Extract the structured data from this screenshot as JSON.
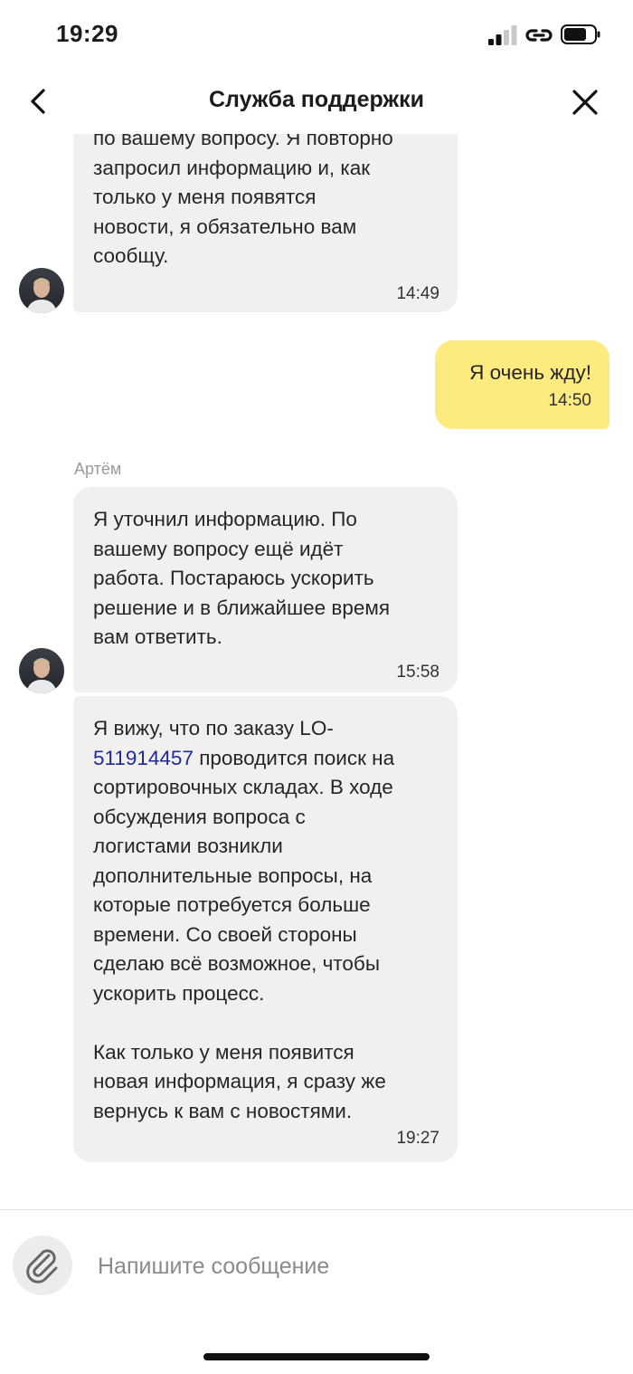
{
  "status_bar": {
    "time": "19:29",
    "icons": [
      "cellular-signal-icon",
      "link-icon",
      "battery-icon"
    ]
  },
  "header": {
    "title": "Служба поддержки",
    "back_icon": "chevron-left-icon",
    "close_icon": "close-icon"
  },
  "messages": [
    {
      "direction": "incoming",
      "text": "по вашему вопросу. Я повторно\nзапросил информацию и, как\nтолько у меня появятся\nновости, я обязательно вам\nсообщу.",
      "time": "14:49"
    },
    {
      "direction": "outgoing",
      "text": "Я очень жду!",
      "time": "14:50"
    },
    {
      "direction": "incoming",
      "sender": "Артём",
      "text": "Я уточнил информацию. По\nвашему вопросу ещё идёт\nработа. Постараюсь ускорить\nрешение и в ближайшее время\nвам ответить.",
      "time": "15:58"
    },
    {
      "direction": "incoming",
      "text_before": "Я вижу, что по заказу LO-\n",
      "link": "511914457",
      "text_after": " проводится поиск на\nсортировочных складах. В ходе\nобсуждения вопроса с\nлогистами возникли\nдополнительные вопросы, на\nкоторые потребуется больше\nвремени. Со своей стороны\nсделаю всё возможное, чтобы\nускорить процесс.\n\nКак только у меня появится\nновая информация, я сразу же\nвернусь к вам с новостями.",
      "time": "19:27"
    }
  ],
  "composer": {
    "placeholder": "Напишите сообщение",
    "attach_icon": "paperclip-icon"
  },
  "colors": {
    "incoming_bubble": "#f1f0ef",
    "outgoing_bubble": "#fdeb80",
    "link": "#1e2a99"
  }
}
